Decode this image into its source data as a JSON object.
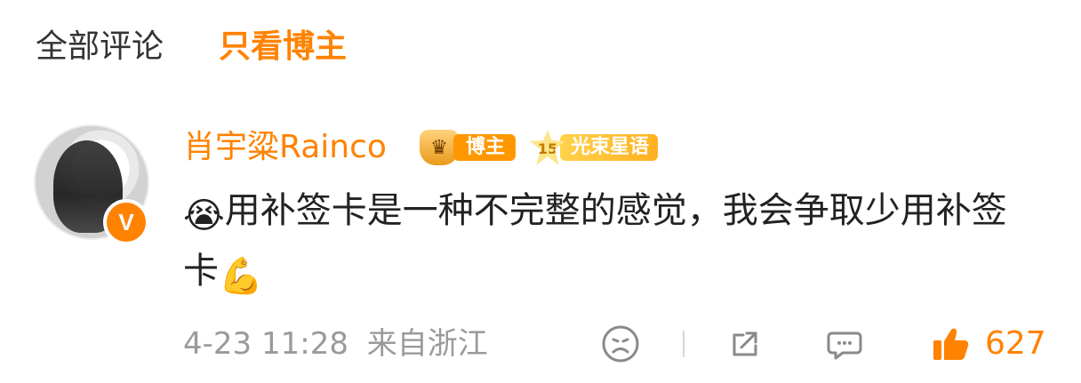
{
  "tabs": {
    "all": "全部评论",
    "blogger_only": "只看博主"
  },
  "comment": {
    "username": "肖宇粱Rainco",
    "badges": {
      "blogger": "博主",
      "star_level": "15",
      "star_name": "光束星语"
    },
    "emoji_prefix": "😭",
    "text": "用补签卡是一种不完整的感觉，我会争取少用补签卡",
    "emoji_suffix": "💪",
    "time": "4-23 11:28",
    "location": "来自浙江",
    "like_count": "627"
  },
  "icons": {
    "verified": "verified-v-icon",
    "reaction": "sad-face-icon",
    "share": "share-icon",
    "reply": "comment-icon",
    "like": "thumbs-up-icon"
  },
  "colors": {
    "accent": "#ff8200",
    "meta": "#9a9a9a",
    "text": "#222222"
  }
}
